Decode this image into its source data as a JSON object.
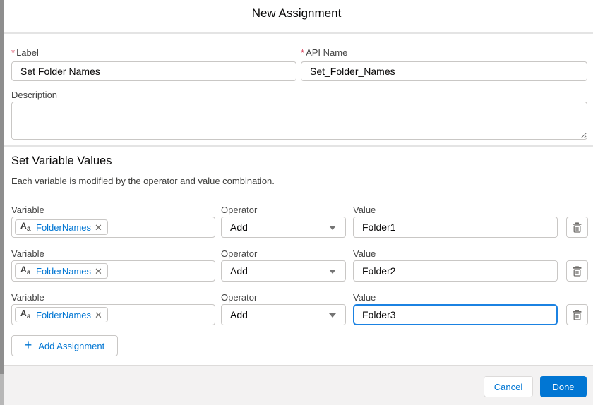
{
  "title": "New Assignment",
  "fields": {
    "label": {
      "required_mark": "*",
      "label": "Label",
      "value": "Set Folder Names"
    },
    "api_name": {
      "required_mark": "*",
      "label": "API Name",
      "value": "Set_Folder_Names"
    },
    "description": {
      "label": "Description",
      "value": ""
    }
  },
  "section": {
    "heading": "Set Variable Values",
    "subheading": "Each variable is modified by the operator and value combination."
  },
  "columns": {
    "variable": "Variable",
    "operator": "Operator",
    "value": "Value"
  },
  "rows": [
    {
      "pill_icon": "Aa",
      "pill_label": "FolderNames",
      "pill_remove": "✕",
      "operator": "Add",
      "value": "Folder1"
    },
    {
      "pill_icon": "Aa",
      "pill_label": "FolderNames",
      "pill_remove": "✕",
      "operator": "Add",
      "value": "Folder2"
    },
    {
      "pill_icon": "Aa",
      "pill_label": "FolderNames",
      "pill_remove": "✕",
      "operator": "Add",
      "value": "Folder3"
    }
  ],
  "add_assignment": {
    "icon": "+",
    "label": "Add Assignment"
  },
  "footer": {
    "cancel_label": "Cancel",
    "done_label": "Done"
  },
  "colors": {
    "brand": "#0176d3",
    "required": "#d9455f",
    "focus_border": "#1b82e2"
  }
}
